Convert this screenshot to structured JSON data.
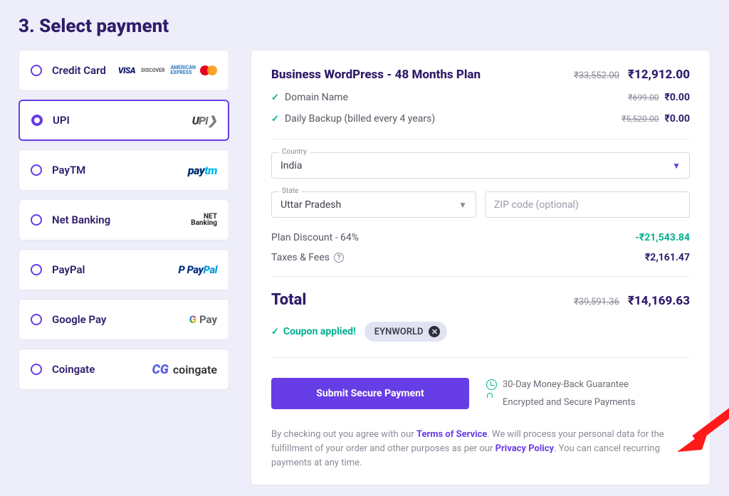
{
  "heading": "3. Select payment",
  "methods": [
    {
      "key": "credit-card",
      "label": "Credit Card",
      "selected": false
    },
    {
      "key": "upi",
      "label": "UPI",
      "selected": true
    },
    {
      "key": "paytm",
      "label": "PayTM",
      "selected": false
    },
    {
      "key": "netbanking",
      "label": "Net Banking",
      "selected": false
    },
    {
      "key": "paypal",
      "label": "PayPal",
      "selected": false
    },
    {
      "key": "googlepay",
      "label": "Google Pay",
      "selected": false
    },
    {
      "key": "coingate",
      "label": "Coingate",
      "selected": false
    }
  ],
  "plan": {
    "name": "Business WordPress - 48 Months Plan",
    "original": "₹33,552.00",
    "price": "₹12,912.00"
  },
  "includes": [
    {
      "label": "Domain Name",
      "original": "₹699.00",
      "price": "₹0.00"
    },
    {
      "label": "Daily Backup (billed every 4 years)",
      "original": "₹5,520.00",
      "price": "₹0.00"
    }
  ],
  "country_field": {
    "label": "Country",
    "value": "India"
  },
  "state_field": {
    "label": "State",
    "value": "Uttar Pradesh"
  },
  "zip_field": {
    "placeholder": "ZIP code (optional)"
  },
  "discount": {
    "label": "Plan Discount - 64%",
    "value": "-₹21,543.84"
  },
  "fees": {
    "label": "Taxes & Fees",
    "value": "₹2,161.47"
  },
  "total": {
    "label": "Total",
    "original": "₹39,591.36",
    "value": "₹14,169.63"
  },
  "coupon": {
    "applied_label": "Coupon applied!",
    "code": "EYNWORLD"
  },
  "submit_label": "Submit Secure Payment",
  "assurances": {
    "moneyback": "30-Day Money-Back Guarantee",
    "encrypted": "Encrypted and Secure Payments"
  },
  "legal": {
    "pre": "By checking out you agree with our ",
    "tos": "Terms of Service",
    "mid": ". We will process your personal data for the fulfillment of your order and other purposes as per our ",
    "pp": "Privacy Policy",
    "post": ". You can cancel recurring payments at any time."
  },
  "colors": {
    "accent": "#673de6",
    "green": "#00b090"
  }
}
